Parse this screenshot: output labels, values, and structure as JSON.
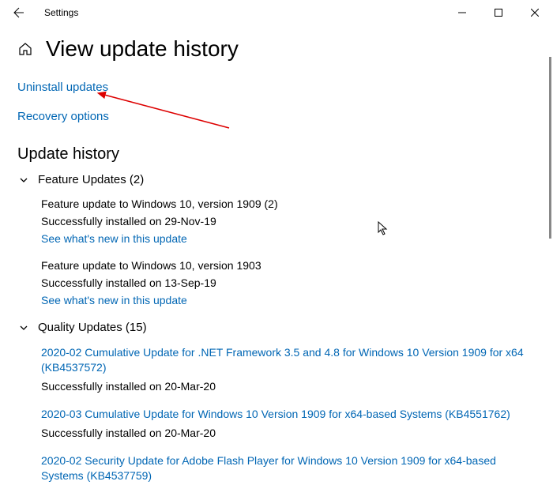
{
  "window": {
    "app_title": "Settings"
  },
  "page": {
    "title": "View update history",
    "links": {
      "uninstall": "Uninstall updates",
      "recovery": "Recovery options"
    },
    "history_heading": "Update history"
  },
  "groups": {
    "feature": {
      "label": "Feature Updates (2)",
      "items": [
        {
          "title": "Feature update to Windows 10, version 1909 (2)",
          "status": "Successfully installed on 29-Nov-19",
          "link": "See what's new in this update"
        },
        {
          "title": "Feature update to Windows 10, version 1903",
          "status": "Successfully installed on 13-Sep-19",
          "link": "See what's new in this update"
        }
      ]
    },
    "quality": {
      "label": "Quality Updates (15)",
      "items": [
        {
          "title": "2020-02 Cumulative Update for .NET Framework 3.5 and 4.8 for Windows 10 Version 1909 for x64 (KB4537572)",
          "status": "Successfully installed on 20-Mar-20"
        },
        {
          "title": "2020-03 Cumulative Update for Windows 10 Version 1909 for x64-based Systems (KB4551762)",
          "status": "Successfully installed on 20-Mar-20"
        },
        {
          "title": "2020-02 Security Update for Adobe Flash Player for Windows 10 Version 1909 for x64-based Systems (KB4537759)",
          "status": ""
        }
      ]
    }
  }
}
